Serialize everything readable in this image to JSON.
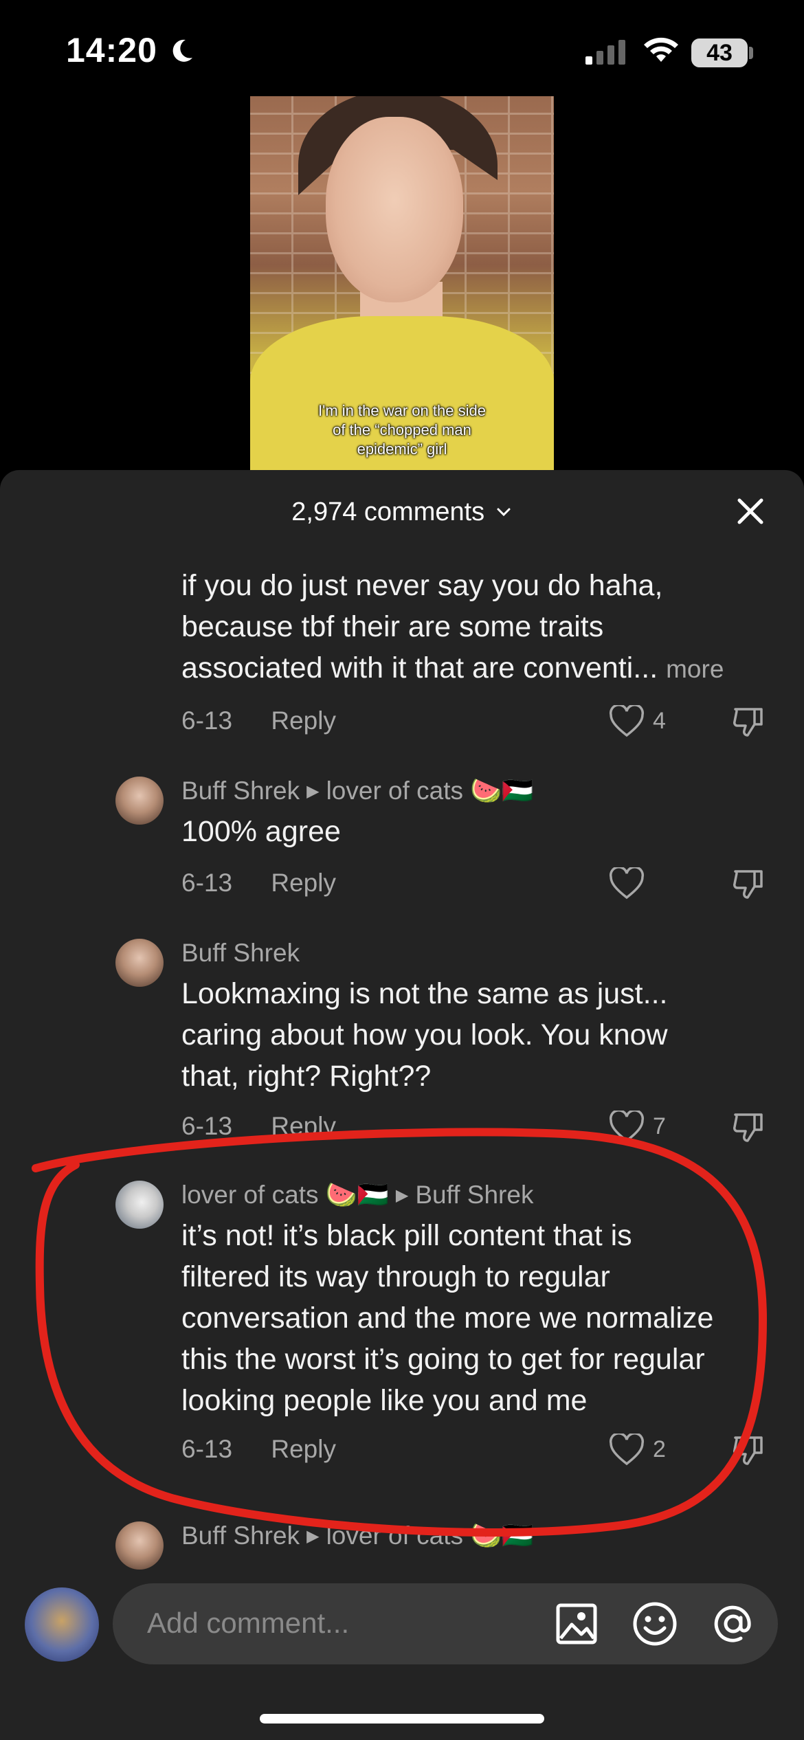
{
  "status_bar": {
    "time": "14:20",
    "battery": "43"
  },
  "video": {
    "caption_lines": [
      "I'm in the war on the side",
      "of the “chopped man",
      "epidemic” girl"
    ]
  },
  "sheet": {
    "comment_count": "2,974 comments",
    "comments": [
      {
        "body_lines": [
          "if you do just never say you do haha,",
          "because tbf their are some traits",
          "associated with it that are conventi..."
        ],
        "more": "more",
        "date": "6-13",
        "reply": "Reply",
        "likes": "4"
      },
      {
        "author": "Buff Shrek",
        "reply_to": "lover of cats 🍉🇵🇸",
        "body_lines": [
          "100% agree"
        ],
        "date": "6-13",
        "reply": "Reply",
        "likes": ""
      },
      {
        "author": "Buff Shrek",
        "body_lines": [
          "Lookmaxing is not the same as just...",
          "caring about how you look. You know",
          "that, right? Right??"
        ],
        "date": "6-13",
        "reply": "Reply",
        "likes": "7"
      },
      {
        "author": "lover of cats 🍉🇵🇸",
        "reply_to": "Buff Shrek",
        "body_lines": [
          "it’s not! it’s black pill content that is",
          "filtered its way through to regular",
          "conversation and the more we normalize",
          "this the worst it’s going to get for regular",
          "looking people like you and me"
        ],
        "date": "6-13",
        "reply": "Reply",
        "likes": "2"
      },
      {
        "author": "Buff Shrek",
        "reply_to": "lover of cats 🍉🇵🇸"
      }
    ]
  },
  "input": {
    "placeholder": "Add comment..."
  },
  "colors": {
    "background": "#000000",
    "sheet": "#232323",
    "annotation": "#e3231b",
    "muted_text": "#a8a8a8"
  }
}
